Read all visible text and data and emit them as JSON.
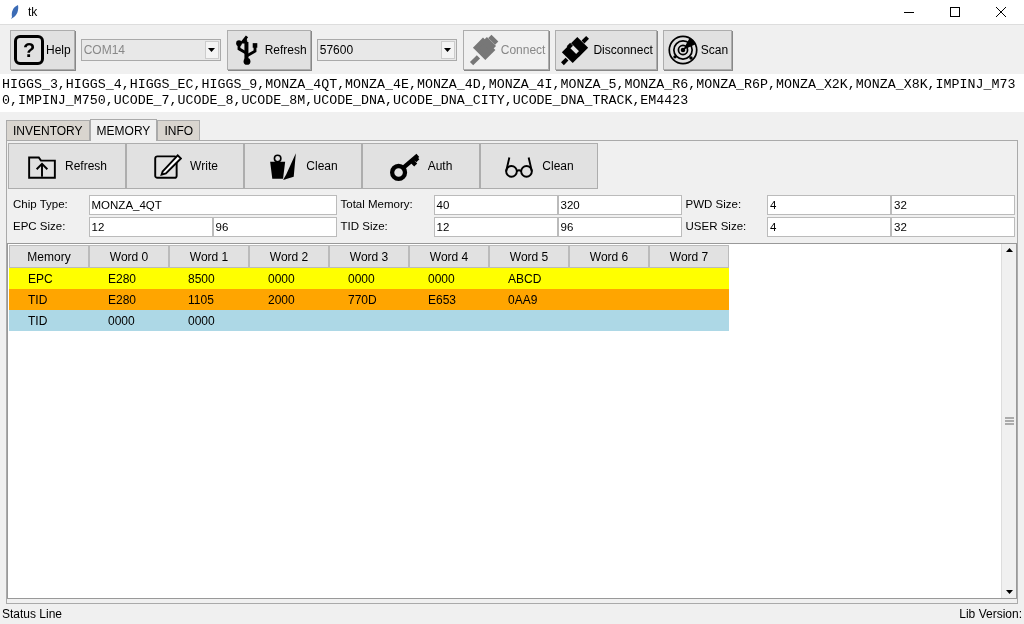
{
  "window": {
    "title": "tk"
  },
  "toolbar": [
    {
      "kind": "button",
      "glyph": "?",
      "label": "Help",
      "disabled": false
    },
    {
      "kind": "combo",
      "value": "COM14",
      "disabled": true
    },
    {
      "kind": "button",
      "label": "Refresh",
      "disabled": false
    },
    {
      "kind": "combo",
      "value": "57600",
      "disabled": false
    },
    {
      "kind": "button",
      "label": "Connect",
      "disabled": true
    },
    {
      "kind": "button",
      "label": "Disconnect",
      "disabled": false
    },
    {
      "kind": "button",
      "label": "Scan",
      "disabled": false
    }
  ],
  "chip_list": "HIGGS_3,HIGGS_4,HIGGS_EC,HIGGS_9,MONZA_4QT,MONZA_4E,MONZA_4D,MONZA_4I,MONZA_5,MONZA_R6,MONZA_R6P,MONZA_X2K,MONZA_X8K,IMPINJ_M730,IMPINJ_M750,UCODE_7,UCODE_8,UCODE_8M,UCODE_DNA,UCODE_DNA_CITY,UCODE_DNA_TRACK,EM4423",
  "tabs": [
    {
      "label": "INVENTORY",
      "selected": false
    },
    {
      "label": "MEMORY",
      "selected": true
    },
    {
      "label": "INFO",
      "selected": false
    }
  ],
  "memory_toolbar": [
    {
      "label": "Refresh"
    },
    {
      "label": "Write"
    },
    {
      "label": "Clean"
    },
    {
      "label": "Auth"
    },
    {
      "label": "Clean"
    }
  ],
  "fields": [
    {
      "label": "Chip Type:",
      "values": [
        "MONZA_4QT"
      ]
    },
    {
      "label": "Total Memory:",
      "values": [
        "40",
        "320"
      ]
    },
    {
      "label": "PWD Size:",
      "values": [
        "4",
        "32"
      ]
    },
    {
      "label": "EPC Size:",
      "values": [
        "12",
        "96"
      ]
    },
    {
      "label": "TID Size:",
      "values": [
        "12",
        "96"
      ]
    },
    {
      "label": "USER Size:",
      "values": [
        "4",
        "32"
      ]
    }
  ],
  "table": {
    "columns": [
      "Memory",
      "Word 0",
      "Word 1",
      "Word 2",
      "Word 3",
      "Word 4",
      "Word 5",
      "Word 6",
      "Word 7"
    ],
    "rows": [
      {
        "color": "#ffff00",
        "cells": [
          "EPC",
          "E280",
          "8500",
          "0000",
          "0000",
          "0000",
          "ABCD"
        ]
      },
      {
        "color": "#ffa500",
        "cells": [
          "TID",
          "E280",
          "1105",
          "2000",
          "770D",
          "E653",
          "0AA9"
        ]
      },
      {
        "color": "#add8e6",
        "cells": [
          "TID",
          "0000",
          "0000"
        ]
      }
    ]
  },
  "status_bar": {
    "left": "Status Line",
    "right": "Lib Version:"
  }
}
